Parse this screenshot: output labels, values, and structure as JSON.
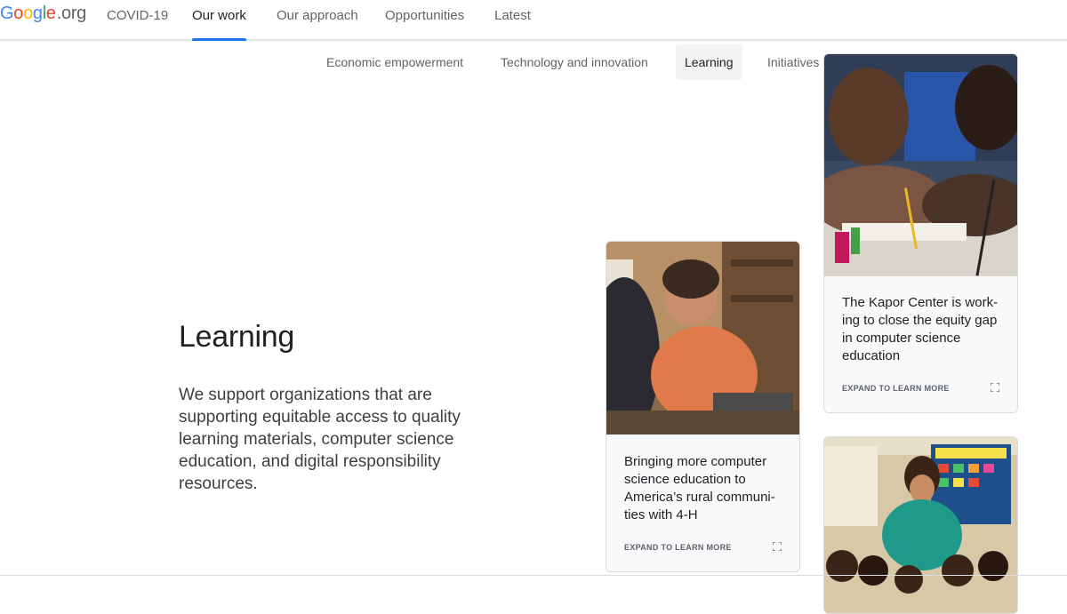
{
  "logo": {
    "letters": [
      "G",
      "o",
      "o",
      "g",
      "l",
      "e"
    ],
    "suffix": ".org",
    "colors": [
      "#4285F4",
      "#EA4335",
      "#FBBC05",
      "#4285F4",
      "#34A853",
      "#EA4335"
    ]
  },
  "topnav": {
    "items": [
      {
        "label": "COVID-19"
      },
      {
        "label": "Our work"
      },
      {
        "label": "Our approach"
      },
      {
        "label": "Opportunities"
      },
      {
        "label": "Latest"
      }
    ],
    "active": "Our work",
    "accent": "#1a73e8"
  },
  "subnav": {
    "items": [
      {
        "label": "Economic empowerment"
      },
      {
        "label": "Technology and innovation"
      },
      {
        "label": "Learning"
      },
      {
        "label": "Initiatives in the U.S."
      }
    ],
    "active": "Learning"
  },
  "main": {
    "title": "Learning",
    "description": "We support organizations that are supporting equitable access to quality learning materials, computer science education, and digital responsibility resources."
  },
  "cards": [
    {
      "title": "The Kapor Center is work-ing to close the equity gap in computer science education",
      "cta": "EXPAND TO LEARN MORE"
    },
    {
      "title": "Bringing more computer science education to America’s rural communi-ties with 4-H",
      "cta": "EXPAND TO LEARN MORE"
    },
    {
      "title": "",
      "cta": ""
    }
  ],
  "icons": {
    "expand": "expand-icon"
  }
}
